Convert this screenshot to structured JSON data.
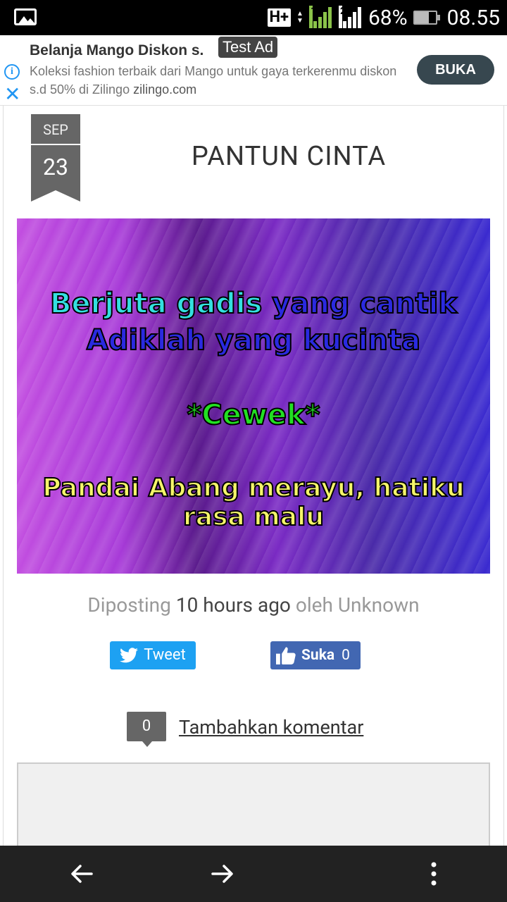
{
  "status_bar": {
    "network_badge": "H+",
    "battery_text": "68%",
    "time": "08.55",
    "sim1_label": "1",
    "sim2_label": "2",
    "icons": [
      "gallery-icon",
      "data-arrows-icon",
      "signal-icon",
      "signal-icon",
      "battery-icon"
    ]
  },
  "ad": {
    "label": "Test Ad",
    "title": "Belanja Mango Diskon s.",
    "description": "Koleksi fashion terbaik dari Mango untuk gaya terkerenmu diskon s.d 50% di Zilingo",
    "domain": "zilingo.com",
    "cta": "BUKA",
    "info_glyph": "i",
    "close_glyph": "✕"
  },
  "post": {
    "date_month": "SEP",
    "date_day": "23",
    "title": "PANTUN CINTA",
    "image_text": {
      "line1_part1": "Berjuta gadis",
      "line1_part2": "yang cantik",
      "line2": "Adiklah yang kucinta",
      "line3": "*Cewek*",
      "line4": "Pandai Abang merayu, hatiku rasa malu"
    },
    "posted_prefix": "Diposting",
    "posted_time": "10 hours ago",
    "posted_by_prefix": "oleh",
    "author": "Unknown"
  },
  "social": {
    "tweet_label": "Tweet",
    "like_label": "Suka",
    "like_count": "0"
  },
  "comments": {
    "count": "0",
    "add_label": "Tambahkan komentar"
  },
  "colors": {
    "twitter": "#1da1f2",
    "facebook": "#4267b2",
    "ad_button": "#37474f",
    "date_badge": "#666666"
  }
}
